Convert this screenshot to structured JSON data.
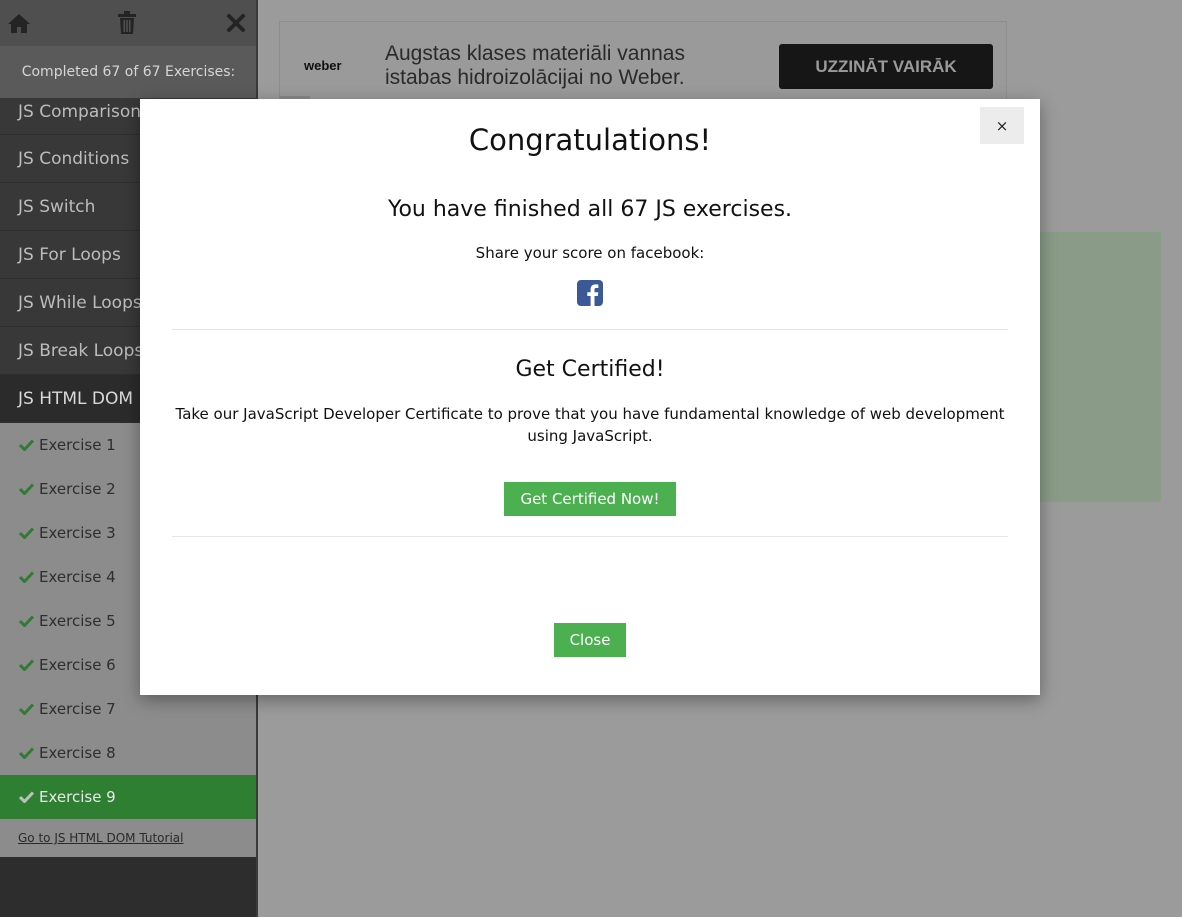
{
  "sidebar": {
    "toolbar": {
      "home_icon": "home-icon",
      "trash_icon": "trash-icon",
      "close_icon": "close-icon"
    },
    "completed_text": "Completed 67 of 67 Exercises:",
    "topics": [
      "JS Comparisons",
      "JS Conditions",
      "JS Switch",
      "JS For Loops",
      "JS While Loops",
      "JS Break Loops",
      "JS HTML DOM"
    ],
    "exercises": [
      "Exercise 1",
      "Exercise 2",
      "Exercise 3",
      "Exercise 4",
      "Exercise 5",
      "Exercise 6",
      "Exercise 7",
      "Exercise 8",
      "Exercise 9"
    ],
    "tutorial_link": "Go to JS HTML DOM Tutorial"
  },
  "ad": {
    "logo": "weber",
    "text": "Augstas klases materiāli vannas istabas hidroizolācijai no Weber.",
    "button": "UZZINĀT VAIRĀK"
  },
  "modal": {
    "title": "Congratulations!",
    "close_x": "×",
    "finished": "You have finished all 67 JS exercises.",
    "share": "Share your score on facebook:",
    "certified_title": "Get Certified!",
    "certified_desc": "Take our JavaScript Developer Certificate to prove that you have fundamental knowledge of web development using JavaScript.",
    "cert_button": "Get Certified Now!",
    "close_button": "Close"
  },
  "colors": {
    "accent_green": "#4caf50",
    "current_exercise_bg": "#2f7f33",
    "facebook_blue": "#3b5998"
  }
}
